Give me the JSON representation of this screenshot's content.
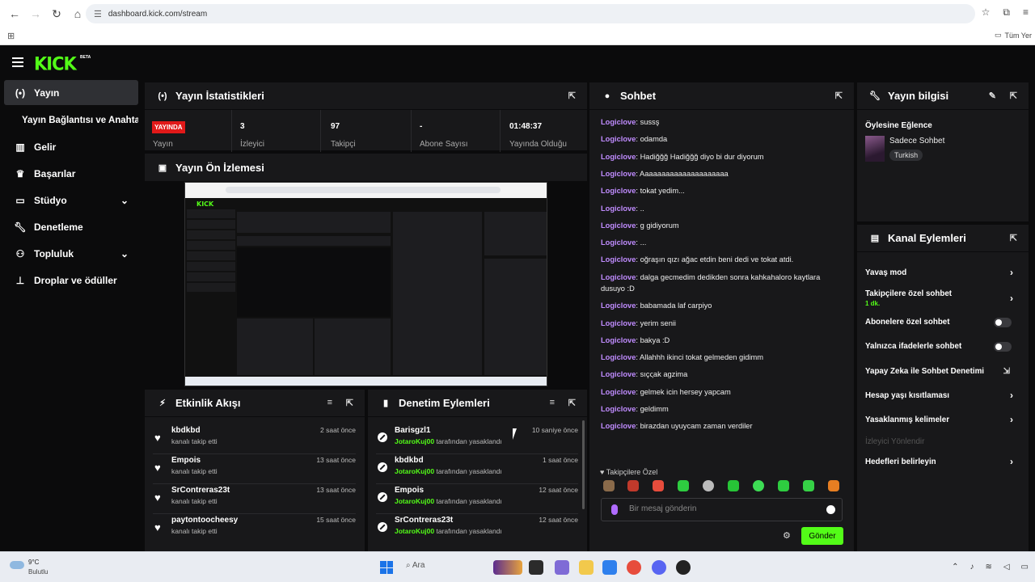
{
  "browser": {
    "url": "dashboard.kick.com/stream",
    "bookmarks_right": "Tüm Yer"
  },
  "brand": {
    "logo": "KICK",
    "badge": "BETA",
    "accent": "#53fc18"
  },
  "sidebar": {
    "items": [
      {
        "label": "Yayın",
        "icon": "broadcast-icon"
      },
      {
        "label": "Yayın Bağlantısı ve Anahtarı"
      },
      {
        "label": "Gelir",
        "icon": "chart-icon"
      },
      {
        "label": "Başarılar",
        "icon": "trophy-icon"
      },
      {
        "label": "Stüdyo",
        "icon": "studio-icon"
      },
      {
        "label": "Denetleme",
        "icon": "wrench-icon"
      },
      {
        "label": "Topluluk",
        "icon": "community-icon"
      },
      {
        "label": "Droplar ve ödüller",
        "icon": "drops-icon"
      }
    ]
  },
  "stats": {
    "title": "Yayın İstatistikleri",
    "live_badge": "YAYINDA",
    "live_label": "Yayın",
    "viewers": {
      "value": "3",
      "label": "İzleyici"
    },
    "followers": {
      "value": "97",
      "label": "Takipçi"
    },
    "subs": {
      "value": "-",
      "label": "Abone Sayısı"
    },
    "uptime": {
      "value": "01:48:37",
      "label": "Yayında Olduğu"
    }
  },
  "preview": {
    "title": "Yayın Ön İzlemesi"
  },
  "activity": {
    "title": "Etkinlik Akışı",
    "items": [
      {
        "name": "kbdkbd",
        "sub": "kanalı takip etti",
        "time": "2 saat önce"
      },
      {
        "name": "Empois",
        "sub": "kanalı takip etti",
        "time": "13 saat önce"
      },
      {
        "name": "SrContreras23t",
        "sub": "kanalı takip etti",
        "time": "13 saat önce"
      },
      {
        "name": "paytontoocheesy",
        "sub": "kanalı takip etti",
        "time": "15 saat önce"
      }
    ]
  },
  "moderation": {
    "title": "Denetim Eylemleri",
    "items": [
      {
        "name": "Barisgzl1",
        "mod": "JotaroKuj00",
        "action": " tarafından yasaklandı",
        "time": "10 saniye önce"
      },
      {
        "name": "kbdkbd",
        "mod": "JotaroKuj00",
        "action": " tarafından yasaklandı",
        "time": "1 saat önce"
      },
      {
        "name": "Empois",
        "mod": "JotaroKuj00",
        "action": " tarafından yasaklandı",
        "time": "12 saat önce"
      },
      {
        "name": "SrContreras23t",
        "mod": "JotaroKuj00",
        "action": " tarafından yasaklandı",
        "time": "12 saat önce"
      }
    ]
  },
  "chat": {
    "title": "Sohbet",
    "messages": [
      {
        "user": "Logiclove",
        "text": ": sussş"
      },
      {
        "user": "Logiclove",
        "text": ": odamda"
      },
      {
        "user": "Logiclove",
        "text": ": Hadiğğğ Hadiğğğ diyo bi dur diyorum"
      },
      {
        "user": "Logiclove",
        "text": ": Aaaaaaaaaaaaaaaaaaaaa"
      },
      {
        "user": "Logiclove",
        "text": ": tokat yedim..."
      },
      {
        "user": "Logiclove",
        "text": ": .."
      },
      {
        "user": "Logiclove",
        "text": ": g gidiyorum"
      },
      {
        "user": "Logiclove",
        "text": ": ..."
      },
      {
        "user": "Logiclove",
        "text": ": oğraşın qızı ağac etdin beni dedi ve tokat atdi."
      },
      {
        "user": "Logiclove",
        "text": ": dalga gecmedim dedikden sonra kahkahaloro kaytlara dusuyo :D"
      },
      {
        "user": "Logiclove",
        "text": ": babamada laf carpiyo"
      },
      {
        "user": "Logiclove",
        "text": ": yerim senii"
      },
      {
        "user": "Logiclove",
        "text": ": bakya :D"
      },
      {
        "user": "Logiclove",
        "text": ": Allahhh ikinci tokat gelmeden gidimm"
      },
      {
        "user": "Logiclove",
        "text": ": sıçςak agzima"
      },
      {
        "user": "Logiclove",
        "text": ": gelmek icin hersey yapcam"
      },
      {
        "user": "Logiclove",
        "text": ": geldimm"
      },
      {
        "user": "Logiclove",
        "text": ": birazdan uyuycam zaman verdiler"
      }
    ],
    "follower_only": "Takipçilere Özel",
    "placeholder": "Bir mesaj gönderin",
    "send": "Gönder"
  },
  "stream_info": {
    "title": "Yayın bilgisi",
    "stream_title": "Öylesine Eğlence",
    "category": "Sadece Sohbet",
    "language": "Turkish"
  },
  "channel_actions": {
    "title": "Kanal Eylemleri",
    "slow_mode": "Yavaş mod",
    "followers_only": "Takipçilere özel sohbet",
    "followers_only_sub": "1 dk.",
    "subs_only": "Abonelere özel sohbet",
    "emotes_only": "Yalnızca ifadelerle sohbet",
    "ai_mod": "Yapay Zeka ile Sohbet Denetimi",
    "age_restriction": "Hesap yaşı kısıtlaması",
    "banned_words": "Yasaklanmış kelimeler",
    "viewer_redirect": "İzleyici Yönlendir",
    "goals": "Hedefleri belirleyin"
  },
  "taskbar": {
    "temp": "9°C",
    "weather": "Bulutlu",
    "search": "Ara"
  }
}
